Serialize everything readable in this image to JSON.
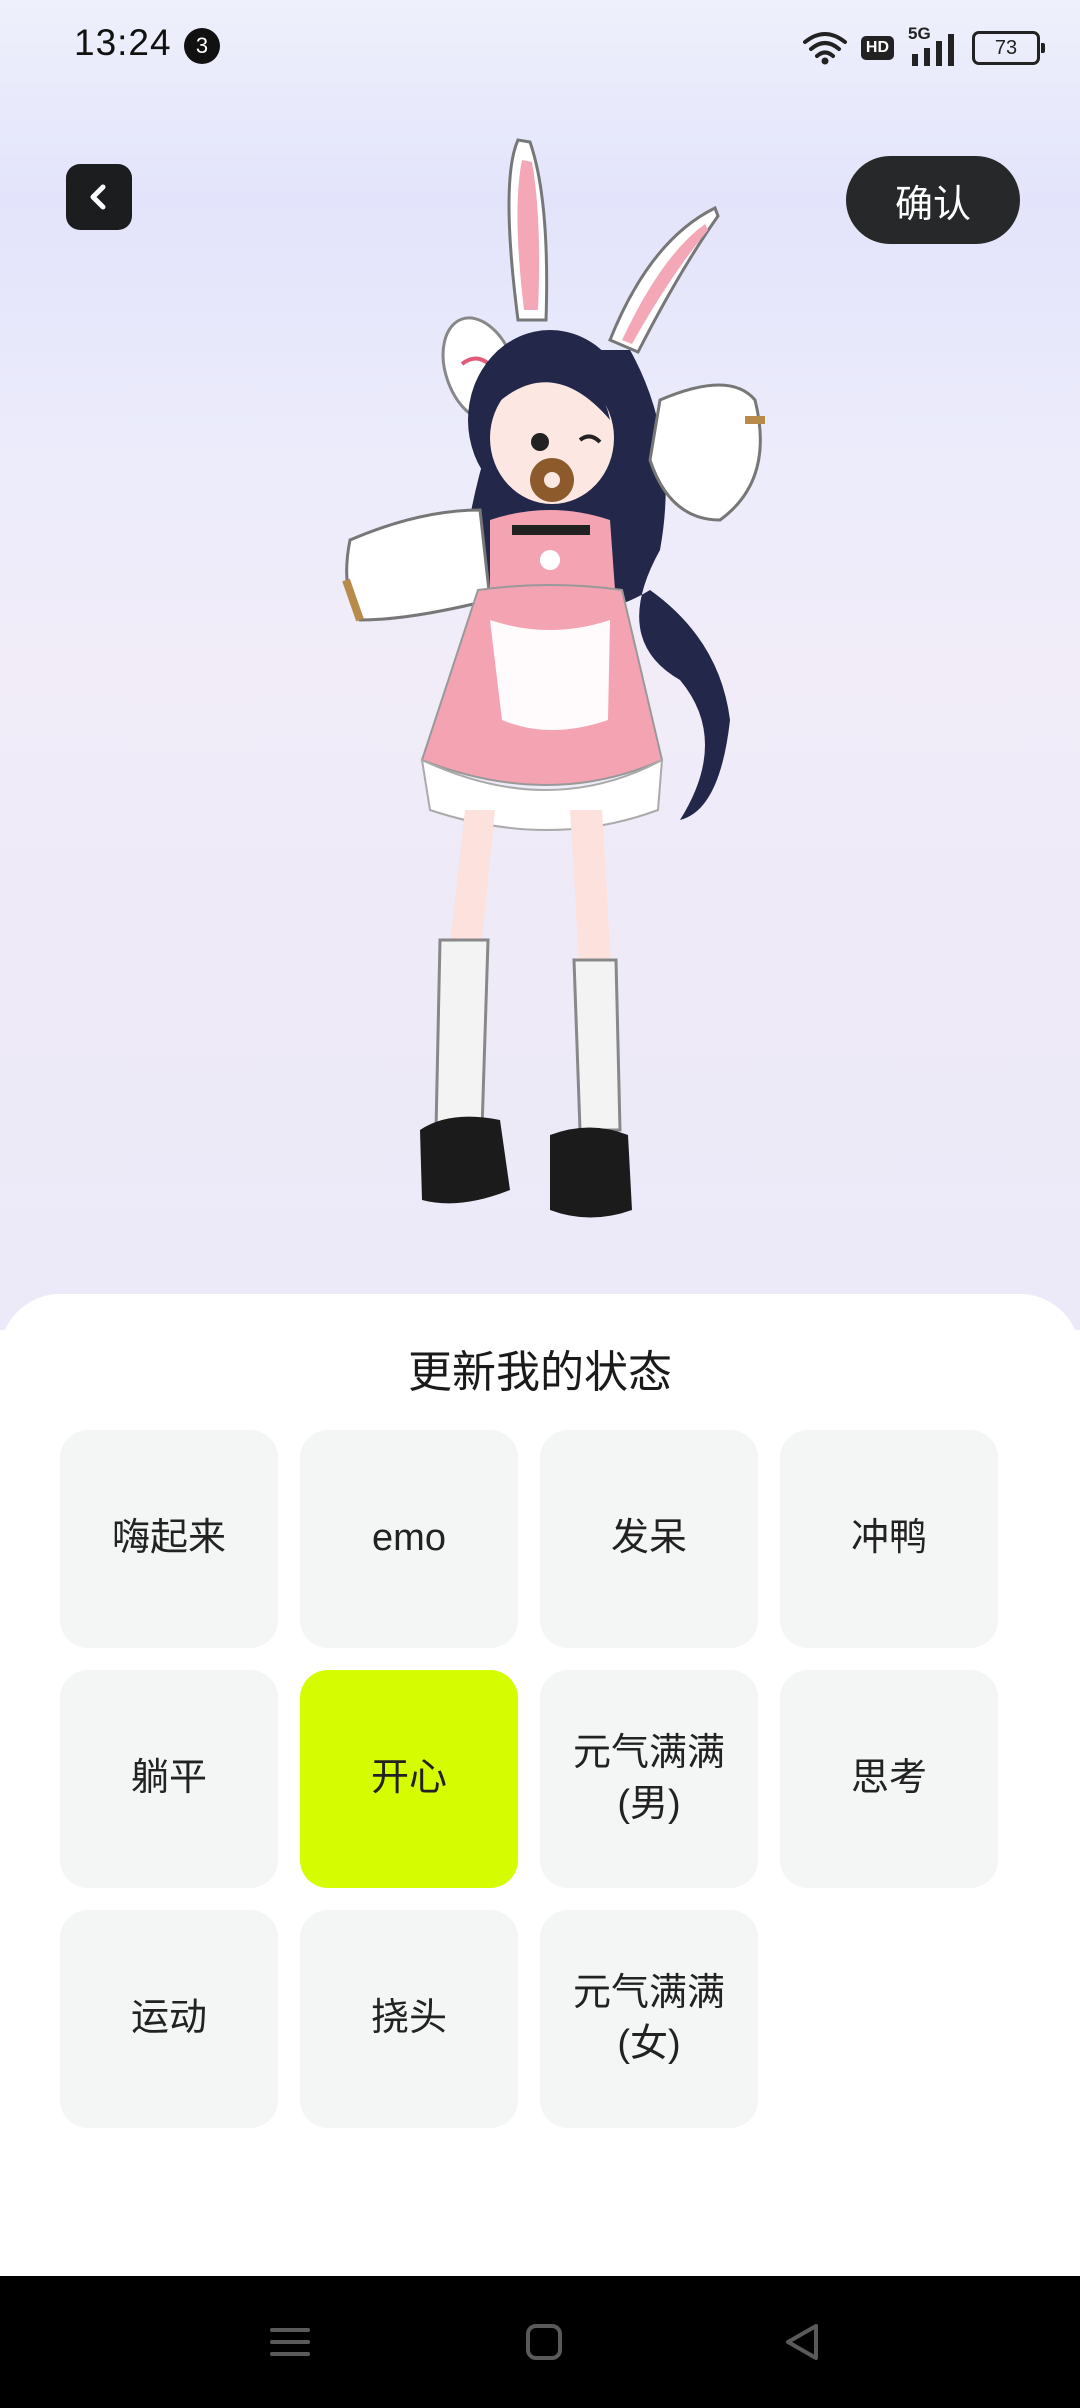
{
  "status_bar": {
    "time": "13:24",
    "notification_count": "3",
    "hd_label": "HD",
    "network": "5G",
    "battery": "73"
  },
  "header": {
    "confirm_label": "确认"
  },
  "sheet": {
    "title": "更新我的状态",
    "selected_color": "#d5fc00",
    "options": [
      {
        "label": "嗨起来",
        "selected": false
      },
      {
        "label": "emo",
        "selected": false
      },
      {
        "label": "发呆",
        "selected": false
      },
      {
        "label": "冲鸭",
        "selected": false
      },
      {
        "label": "躺平",
        "selected": false
      },
      {
        "label": "开心",
        "selected": true
      },
      {
        "label": "元气满满\n(男)",
        "selected": false
      },
      {
        "label": "思考",
        "selected": false
      },
      {
        "label": "运动",
        "selected": false
      },
      {
        "label": "挠头",
        "selected": false
      },
      {
        "label": "元气满满\n(女)",
        "selected": false
      }
    ]
  },
  "icons": {
    "back": "chevron-left-icon",
    "wifi": "wifi-icon",
    "signal": "signal-icon",
    "nav_menu": "menu-icon",
    "nav_home": "home-icon",
    "nav_back": "triangle-back-icon"
  }
}
